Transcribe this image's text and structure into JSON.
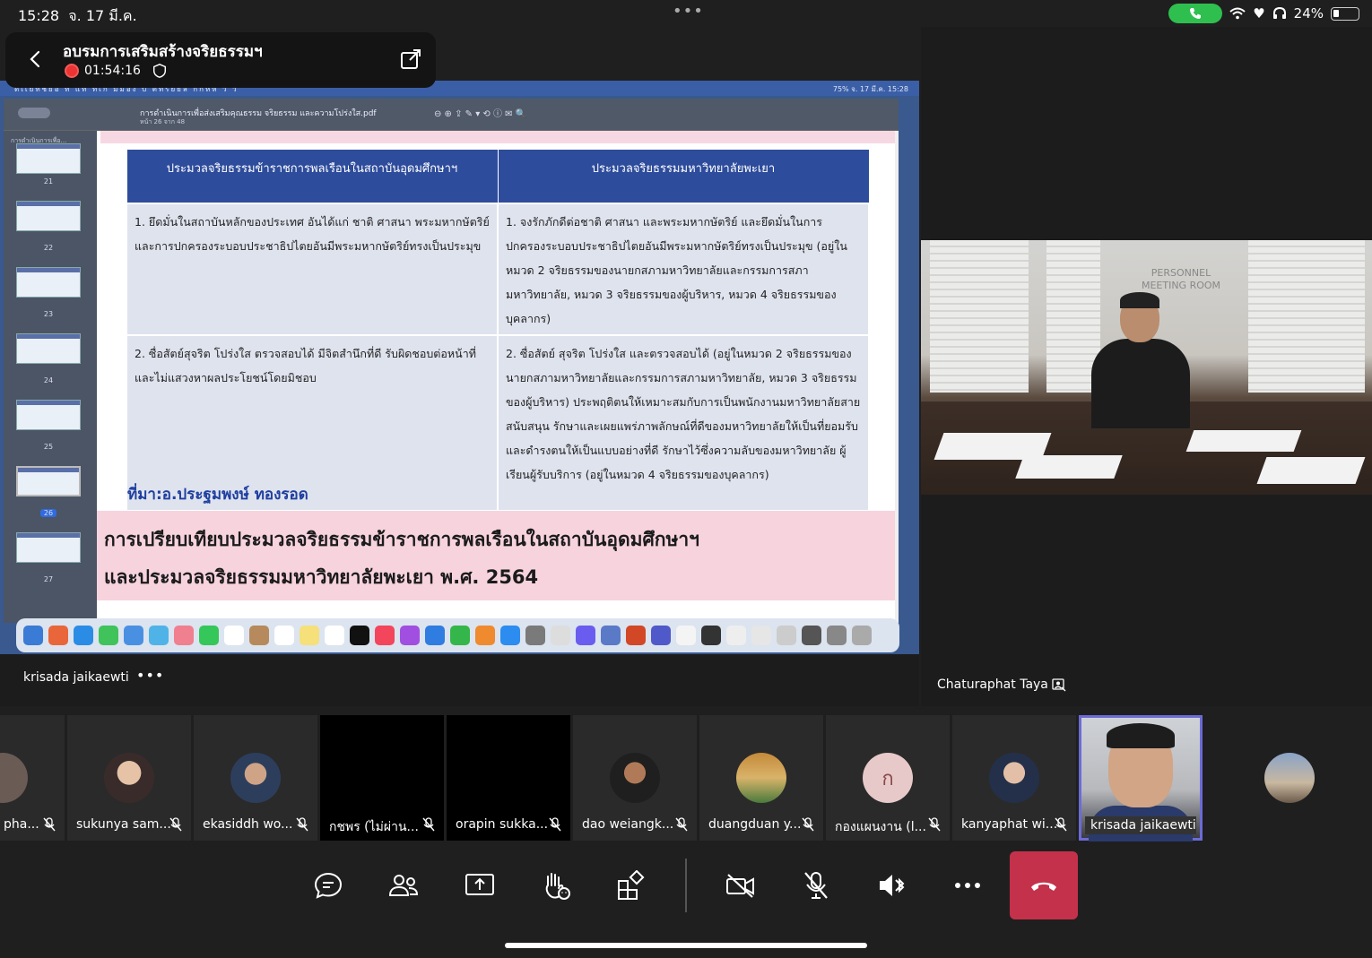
{
  "status_bar": {
    "time": "15:28",
    "date": "จ. 17 มี.ค.",
    "battery": "24%"
  },
  "meeting": {
    "title": "อบรมการเสริมสร้างจริยธรรมฯ",
    "duration": "01:54:16"
  },
  "shared_screen": {
    "mac_menubar_left": "ดเเยทชยอ ท  แท  ทเก  มมอง  บ  ตทรยยล  กกหห  ว ว",
    "mac_menubar_right": "75%   จ. 17 มี.ค.  15:28",
    "pdf_title": "การดำเนินการเพื่อส่งเสริมคุณธรรม จริยธรรม และความโปร่งใส.pdf",
    "pdf_subtitle": "หน้า 26 จาก 48",
    "sidebar_heading": "การดำเนินการเพื่อ...",
    "thumbnails": [
      "21",
      "22",
      "23",
      "24",
      "25",
      "26",
      "27"
    ],
    "active_thumbnail": "26",
    "table": {
      "col1_header": "ประมวลจริยธรรมข้าราชการพลเรือนในสถาบันอุดมศึกษาฯ",
      "col2_header": "ประมวลจริยธรรมมหาวิทยาลัยพะเยา",
      "row1_col1": "1. ยึดมั่นในสถาบันหลักของประเทศ อันได้แก่ ชาติ ศาสนา พระมหากษัตริย์ และการปกครองระบอบประชาธิปไตยอันมีพระมหากษัตริย์ทรงเป็นประมุข",
      "row1_col2": "1. จงรักภักดีต่อชาติ ศาสนา และพระมหากษัตริย์ และยึดมั่นในการปกครองระบอบประชาธิปไตยอันมีพระมหากษัตริย์ทรงเป็นประมุข (อยู่ในหมวด 2 จริยธรรมของนายกสภามหาวิทยาลัยและกรรมการสภามหาวิทยาลัย, หมวด 3 จริยธรรมของผู้บริหาร, หมวด 4 จริยธรรมของบุคลากร)",
      "row2_col1": "2. ซื่อสัตย์สุจริต โปร่งใส ตรวจสอบได้ มีจิตสำนึกที่ดี รับผิดชอบต่อหน้าที่ และไม่แสวงหาผลประโยชน์โดยมิชอบ",
      "row2_col2": "2. ซื่อสัตย์ สุจริต โปร่งใส และตรวจสอบได้ (อยู่ในหมวด 2 จริยธรรมของนายกสภามหาวิทยาลัยและกรรมการสภามหาวิทยาลัย, หมวด 3 จริยธรรมของผู้บริหาร) ประพฤติตนให้เหมาะสมกับการเป็นพนักงานมหาวิทยาลัยสายสนับสนุน รักษาและเผยแพร่ภาพลักษณ์ที่ดีของมหาวิทยาลัยให้เป็นที่ยอมรับ และดำรงตนให้เป็นแบบอย่างที่ดี รักษาไว้ซึ่งความลับของมหาวิทยาลัย ผู้เรียนผู้รับบริการ (อยู่ในหมวด 4 จริยธรรมของบุคลากร)"
    },
    "source": "ที่มา:อ.ประฐมพงษ์ ทองรอด",
    "caption_line1": "การเปรียบเทียบประมวลจริยธรรมข้าราชการพลเรือนในสถาบันอุดมศึกษาฯ",
    "caption_line2": "และประมวลจริยธรรมมหาวิทยาลัยพะเยา พ.ศ. 2564"
  },
  "presenter": {
    "name": "krisada jaikaewti",
    "more": "•••"
  },
  "right_video": {
    "name": "Chaturaphat Taya",
    "door_sign_line1": "PERSONNEL",
    "door_sign_line2": "MEETING ROOM"
  },
  "participants": [
    {
      "name": "pha...",
      "muted": true
    },
    {
      "name": "sukunya sam...",
      "muted": true
    },
    {
      "name": "ekasiddh wo...",
      "muted": true
    },
    {
      "name": "กชพร (ไม่ผ่าน...",
      "muted": true
    },
    {
      "name": "orapin sukka...",
      "muted": true
    },
    {
      "name": "dao weiangk...",
      "muted": true
    },
    {
      "name": "duangduan y...",
      "muted": true
    },
    {
      "name": "กองแผนงาน (l...",
      "muted": true,
      "initial": "ก"
    },
    {
      "name": "kanyaphat wi...",
      "muted": true
    },
    {
      "name": "krisada jaikaewti",
      "muted": false
    },
    {
      "name": "",
      "muted": false
    }
  ],
  "colors": {
    "accent": "#6b6bd6",
    "hangup": "#c4314b",
    "call_green": "#2fbf4f",
    "record": "#e33333"
  }
}
